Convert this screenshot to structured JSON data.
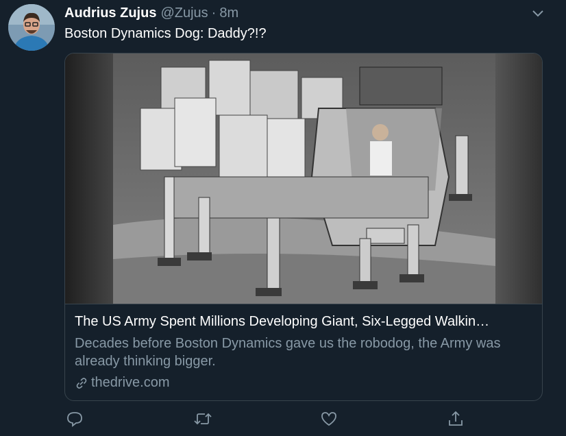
{
  "tweet": {
    "author_name": "Audrius Zujus",
    "author_handle": "@Zujus",
    "separator": "·",
    "time": "8m",
    "text": "Boston Dynamics Dog: Daddy?!?"
  },
  "card": {
    "title": "The US Army Spent Millions Developing Giant, Six-Legged Walkin…",
    "description": "Decades before Boston Dynamics gave us the robodog, the Army was already thinking bigger.",
    "domain": "thedrive.com"
  },
  "icons": {
    "caret": "chevron-down-icon",
    "reply": "reply-icon",
    "retweet": "retweet-icon",
    "like": "heart-icon",
    "share": "share-icon",
    "link": "link-icon"
  },
  "colors": {
    "background": "#15202b",
    "secondary_text": "#8899a6",
    "border": "#38444d"
  }
}
